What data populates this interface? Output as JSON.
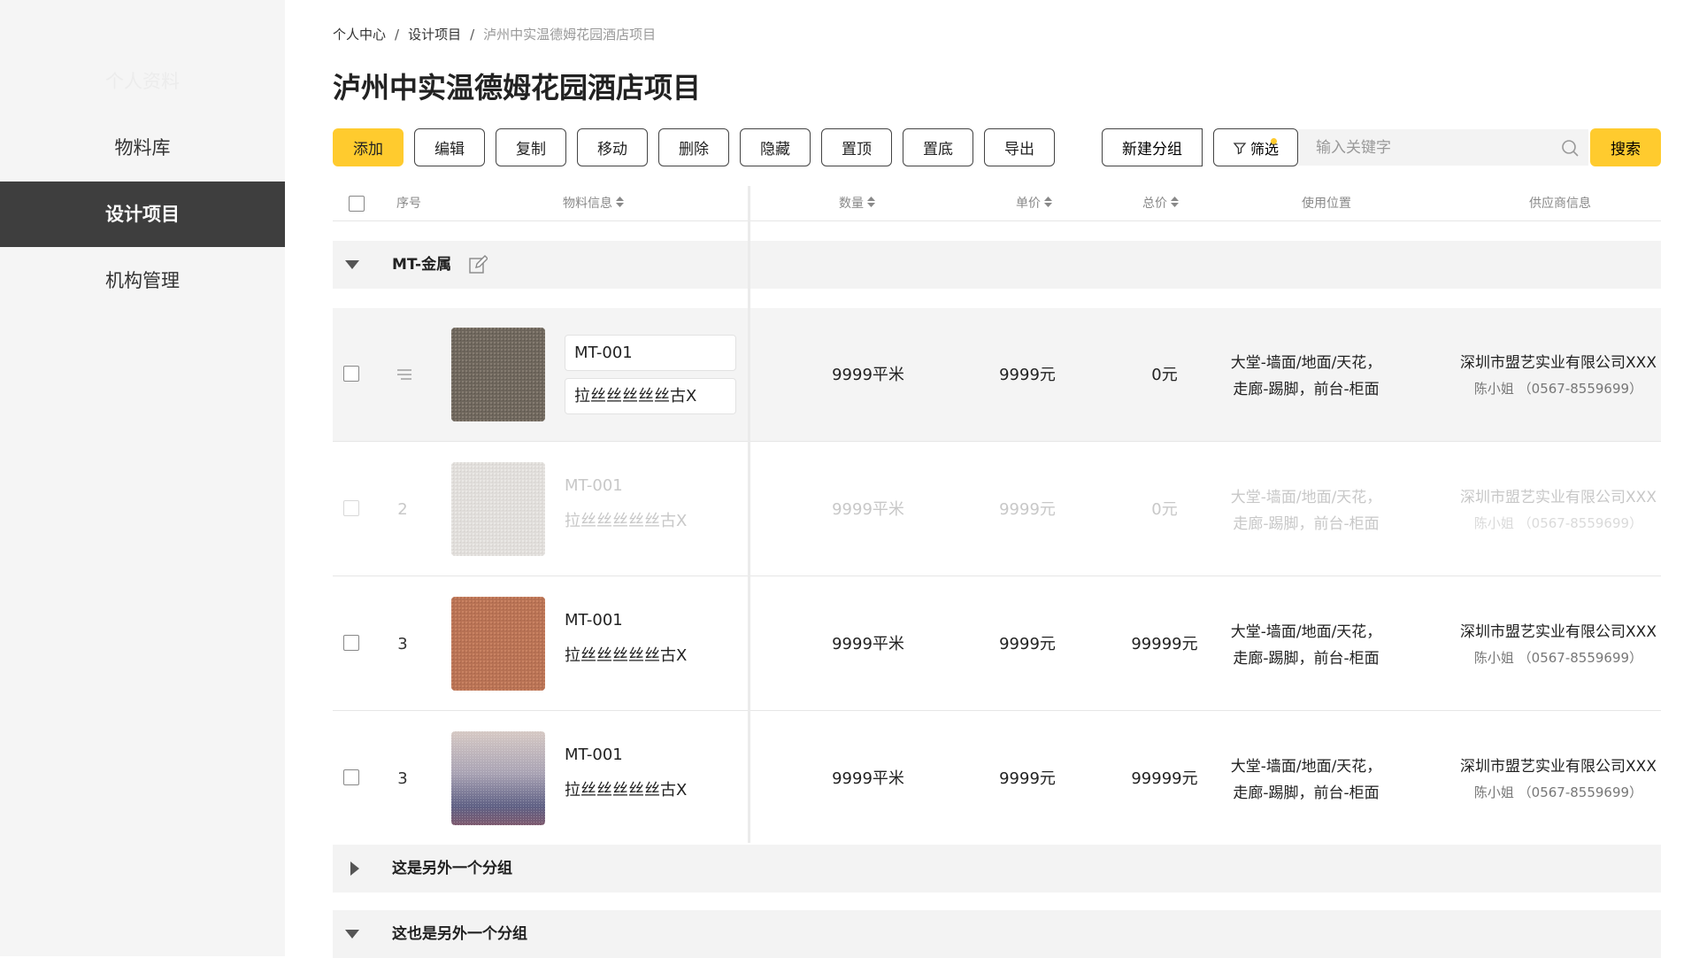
{
  "sidebar": {
    "items": [
      {
        "label": "个人资料"
      },
      {
        "label": "物料库"
      },
      {
        "label": "设计项目"
      },
      {
        "label": "机构管理"
      }
    ]
  },
  "breadcrumb": [
    "个人中心",
    "设计项目",
    "泸州中实温德姆花园酒店项目"
  ],
  "breadcrumb_sep": "/",
  "page": {
    "title": "泸州中实温德姆花园酒店项目"
  },
  "toolbar": {
    "add": "添加",
    "edit": "编辑",
    "copy": "复制",
    "move": "移动",
    "delete": "删除",
    "hide": "隐藏",
    "top": "置顶",
    "bottom": "置底",
    "export": "导出"
  },
  "search": {
    "new_group": "新建分组",
    "filter": "筛选",
    "placeholder": "输入关键字",
    "button": "搜索"
  },
  "table": {
    "headers": [
      "序号",
      "物料信息",
      "数量",
      "单价",
      "总价",
      "使用位置",
      "供应商信息"
    ]
  },
  "groups": [
    {
      "name": "MT-金属",
      "expanded": true
    },
    {
      "name": "这是另外一个分组",
      "expanded": false
    },
    {
      "name": "这也是另外一个分组",
      "expanded": true
    }
  ],
  "rows": [
    {
      "seq": "",
      "code": "MT-001",
      "name": "拉丝丝丝丝丝古X",
      "qty": "9999平米",
      "price": "9999元",
      "total": "0元",
      "loc1": "大堂-墙面/地面/天花，",
      "loc2": "走廊-踢脚，前台-柜面",
      "supplier": "深圳市盟艺实业有限公司XXX",
      "contact": "陈小姐 （0567-8559699）",
      "state": "editing"
    },
    {
      "seq": "2",
      "code": "MT-001",
      "name": "拉丝丝丝丝丝古X",
      "qty": "9999平米",
      "price": "9999元",
      "total": "0元",
      "loc1": "大堂-墙面/地面/天花，",
      "loc2": "走廊-踢脚，前台-柜面",
      "supplier": "深圳市盟艺实业有限公司XXX",
      "contact": "陈小姐 （0567-8559699）",
      "state": "disabled"
    },
    {
      "seq": "3",
      "code": "MT-001",
      "name": "拉丝丝丝丝丝古X",
      "qty": "9999平米",
      "price": "9999元",
      "total": "99999元",
      "loc1": "大堂-墙面/地面/天花，",
      "loc2": "走廊-踢脚，前台-柜面",
      "supplier": "深圳市盟艺实业有限公司XXX",
      "contact": "陈小姐 （0567-8559699）",
      "state": "normal"
    },
    {
      "seq": "3",
      "code": "MT-001",
      "name": "拉丝丝丝丝丝古X",
      "qty": "9999平米",
      "price": "9999元",
      "total": "99999元",
      "loc1": "大堂-墙面/地面/天花，",
      "loc2": "走廊-踢脚，前台-柜面",
      "supplier": "深圳市盟艺实业有限公司XXX",
      "contact": "陈小姐 （0567-8559699）",
      "state": "normal"
    }
  ],
  "colors": {
    "accent": "#ffcb2e",
    "sidebar_active": "#3e3e3e",
    "sidebar_bg": "#f5f5f5"
  },
  "icons": [
    "sort-icon",
    "caret-down-icon",
    "caret-right-icon",
    "edit-icon",
    "drag-handle-icon",
    "filter-icon",
    "search-icon"
  ]
}
